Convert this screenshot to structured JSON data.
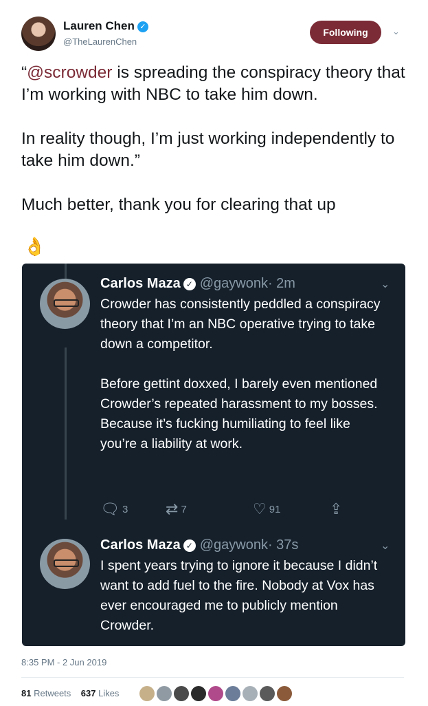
{
  "author": {
    "name": "Lauren Chen",
    "handle": "@TheLaurenChen",
    "follow_label": "Following"
  },
  "tweet": {
    "mention": "@scrowder",
    "text_before": "“",
    "text_after": " is spreading the conspiracy theory that I’m working with NBC to take him down.\n\nIn reality though, I’m just working independently to take him down.”\n\nMuch better, thank you for clearing that up",
    "emoji": "👌",
    "timestamp": "8:35 PM - 2 Jun 2019"
  },
  "embed": {
    "tweets": [
      {
        "name": "Carlos Maza",
        "handle": "@gaywonk",
        "time": "· 2m",
        "text": "Crowder has consistently peddled a conspiracy theory that I’m an NBC operative trying to take down a competitor.\n\nBefore gettint doxxed, I barely even mentioned Crowder’s repeated harassment to my bosses. Because it’s fucking humiliating to feel like you’re a liability at work.",
        "replies": "3",
        "retweets": "7",
        "likes": "91"
      },
      {
        "name": "Carlos Maza",
        "handle": "@gaywonk",
        "time": "· 37s",
        "text": "I spent years trying to ignore it because I didn’t want to add fuel to the fire. Nobody at Vox has ever encouraged me to publicly mention Crowder."
      }
    ]
  },
  "stats": {
    "retweets_count": "81",
    "retweets_label": "Retweets",
    "likes_count": "637",
    "likes_label": "Likes"
  },
  "colors": {
    "accent": "#7b2b36",
    "dark_bg": "#15202b"
  }
}
